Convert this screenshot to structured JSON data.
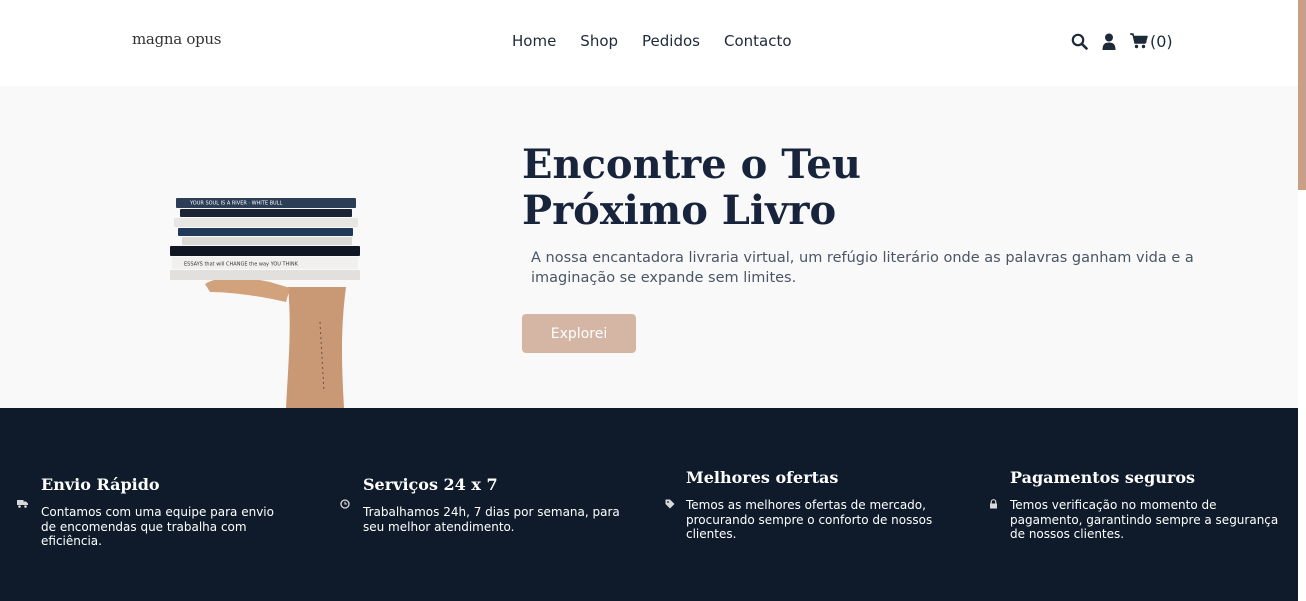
{
  "header": {
    "logo": "magna opus",
    "nav": [
      "Home",
      "Shop",
      "Pedidos",
      "Contacto"
    ],
    "cart_count": "(0)",
    "icons": [
      "search-icon",
      "user-icon",
      "cart-icon"
    ]
  },
  "hero": {
    "title_line1": "Encontre o Teu",
    "title_line2": "Próximo Livro",
    "subtitle": "A nossa encantadora livraria virtual, um refúgio literário onde as palavras ganham vida e a imaginação se expande sem limites.",
    "button": "Explorei",
    "book_spines": [
      "YOUR SOUL IS A RIVER",
      "WHITE BULL",
      "",
      "",
      "",
      "ESSAYS that will CHANGE the way YOU THINK"
    ]
  },
  "features": [
    {
      "title": "Envio Rápido",
      "text": "Contamos com uma equipe para envio de encomendas que trabalha com eficiência.",
      "icon": "truck-icon"
    },
    {
      "title": "Serviços 24 x 7",
      "text": "Trabalhamos 24h, 7 dias por semana, para seu melhor atendimento.",
      "icon": "clock-icon"
    },
    {
      "title": "Melhores ofertas",
      "text": "Temos as melhores ofertas de mercado, procurando sempre o conforto de nossos clientes.",
      "icon": "tag-icon"
    },
    {
      "title": "Pagamentos seguros",
      "text": "Temos verificação no momento de pagamento, garantindo sempre a segurança de nossos clientes.",
      "icon": "lock-icon"
    }
  ],
  "colors": {
    "brand_dark": "#17243b",
    "accent": "#d5b6a4",
    "footer_bg": "#0f1b2b"
  }
}
